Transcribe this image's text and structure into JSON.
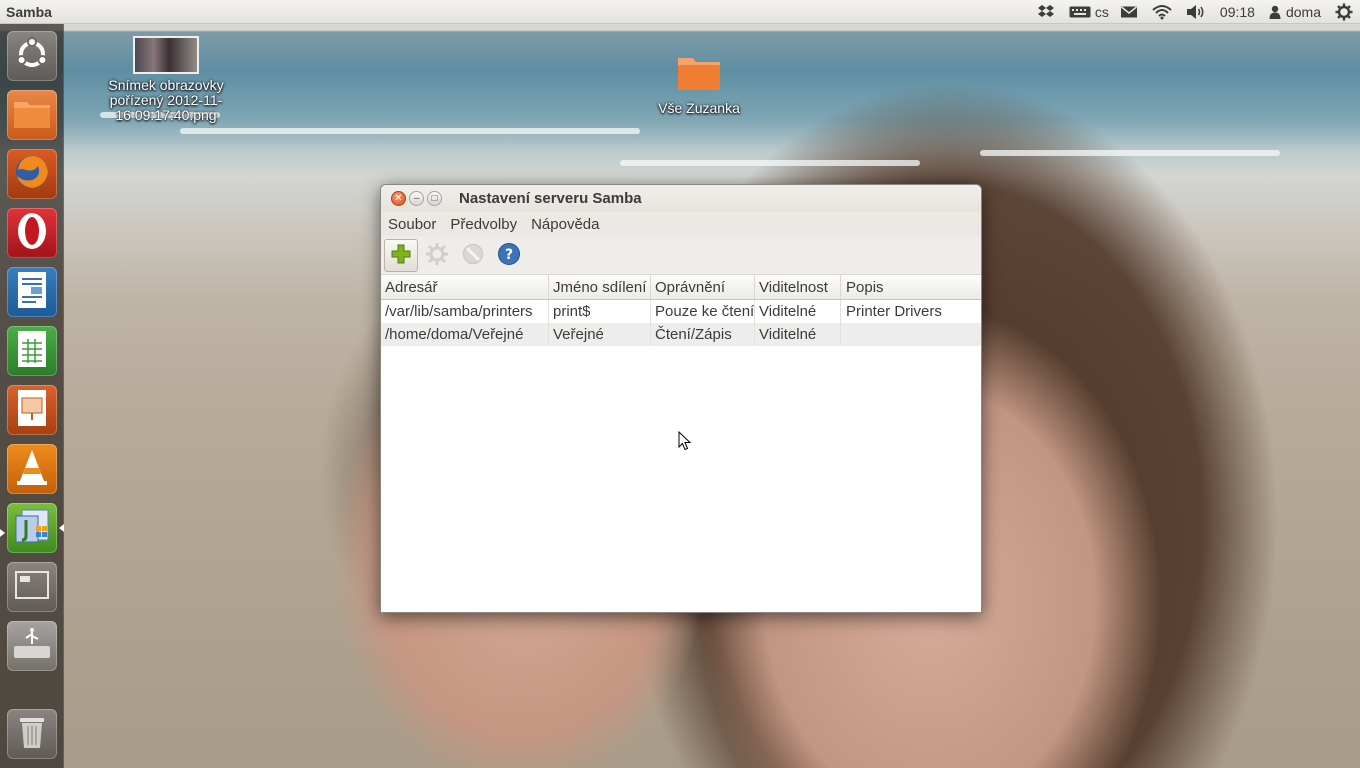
{
  "top_panel": {
    "app_title": "Samba",
    "keyboard_layout": "cs",
    "time": "09:18",
    "user": "doma",
    "icons": [
      "dropbox-icon",
      "keyboard-icon",
      "mail-icon",
      "wifi-icon",
      "volume-icon",
      "user-icon",
      "gear-icon"
    ]
  },
  "launcher": {
    "items": [
      "ubuntu-logo-icon",
      "files-icon",
      "firefox-icon",
      "opera-icon",
      "writer-icon",
      "calc-icon",
      "impress-icon",
      "vlc-icon",
      "samba-icon",
      "workspace-switcher-icon",
      "usb-drive-icon",
      "trash-icon"
    ]
  },
  "desktop": {
    "icons": [
      {
        "label_lines": [
          "Snímek obrazovky",
          "pořízený 2012-11-",
          "16 09:17:40.png"
        ]
      },
      {
        "label_lines": [
          "Vše Zuzanka"
        ]
      }
    ]
  },
  "dialog": {
    "title": "Nastavení serveru Samba",
    "menu": [
      "Soubor",
      "Předvolby",
      "Nápověda"
    ],
    "toolbar_icons": [
      "add-icon",
      "properties-icon",
      "delete-icon",
      "help-icon"
    ],
    "columns": [
      "Adresář",
      "Jméno sdílení",
      "Oprávnění",
      "Viditelnost",
      "Popis"
    ],
    "rows": [
      [
        "/var/lib/samba/printers",
        "print$",
        "Pouze ke čtení",
        "Viditelné",
        "Printer Drivers"
      ],
      [
        "/home/doma/Veřejné",
        "Veřejné",
        "Čtení/Zápis",
        "Viditelné",
        ""
      ]
    ]
  },
  "colors": {
    "close_button": "#df4b16",
    "help_blue": "#3b74b8",
    "add_green": "#7ab51d"
  }
}
